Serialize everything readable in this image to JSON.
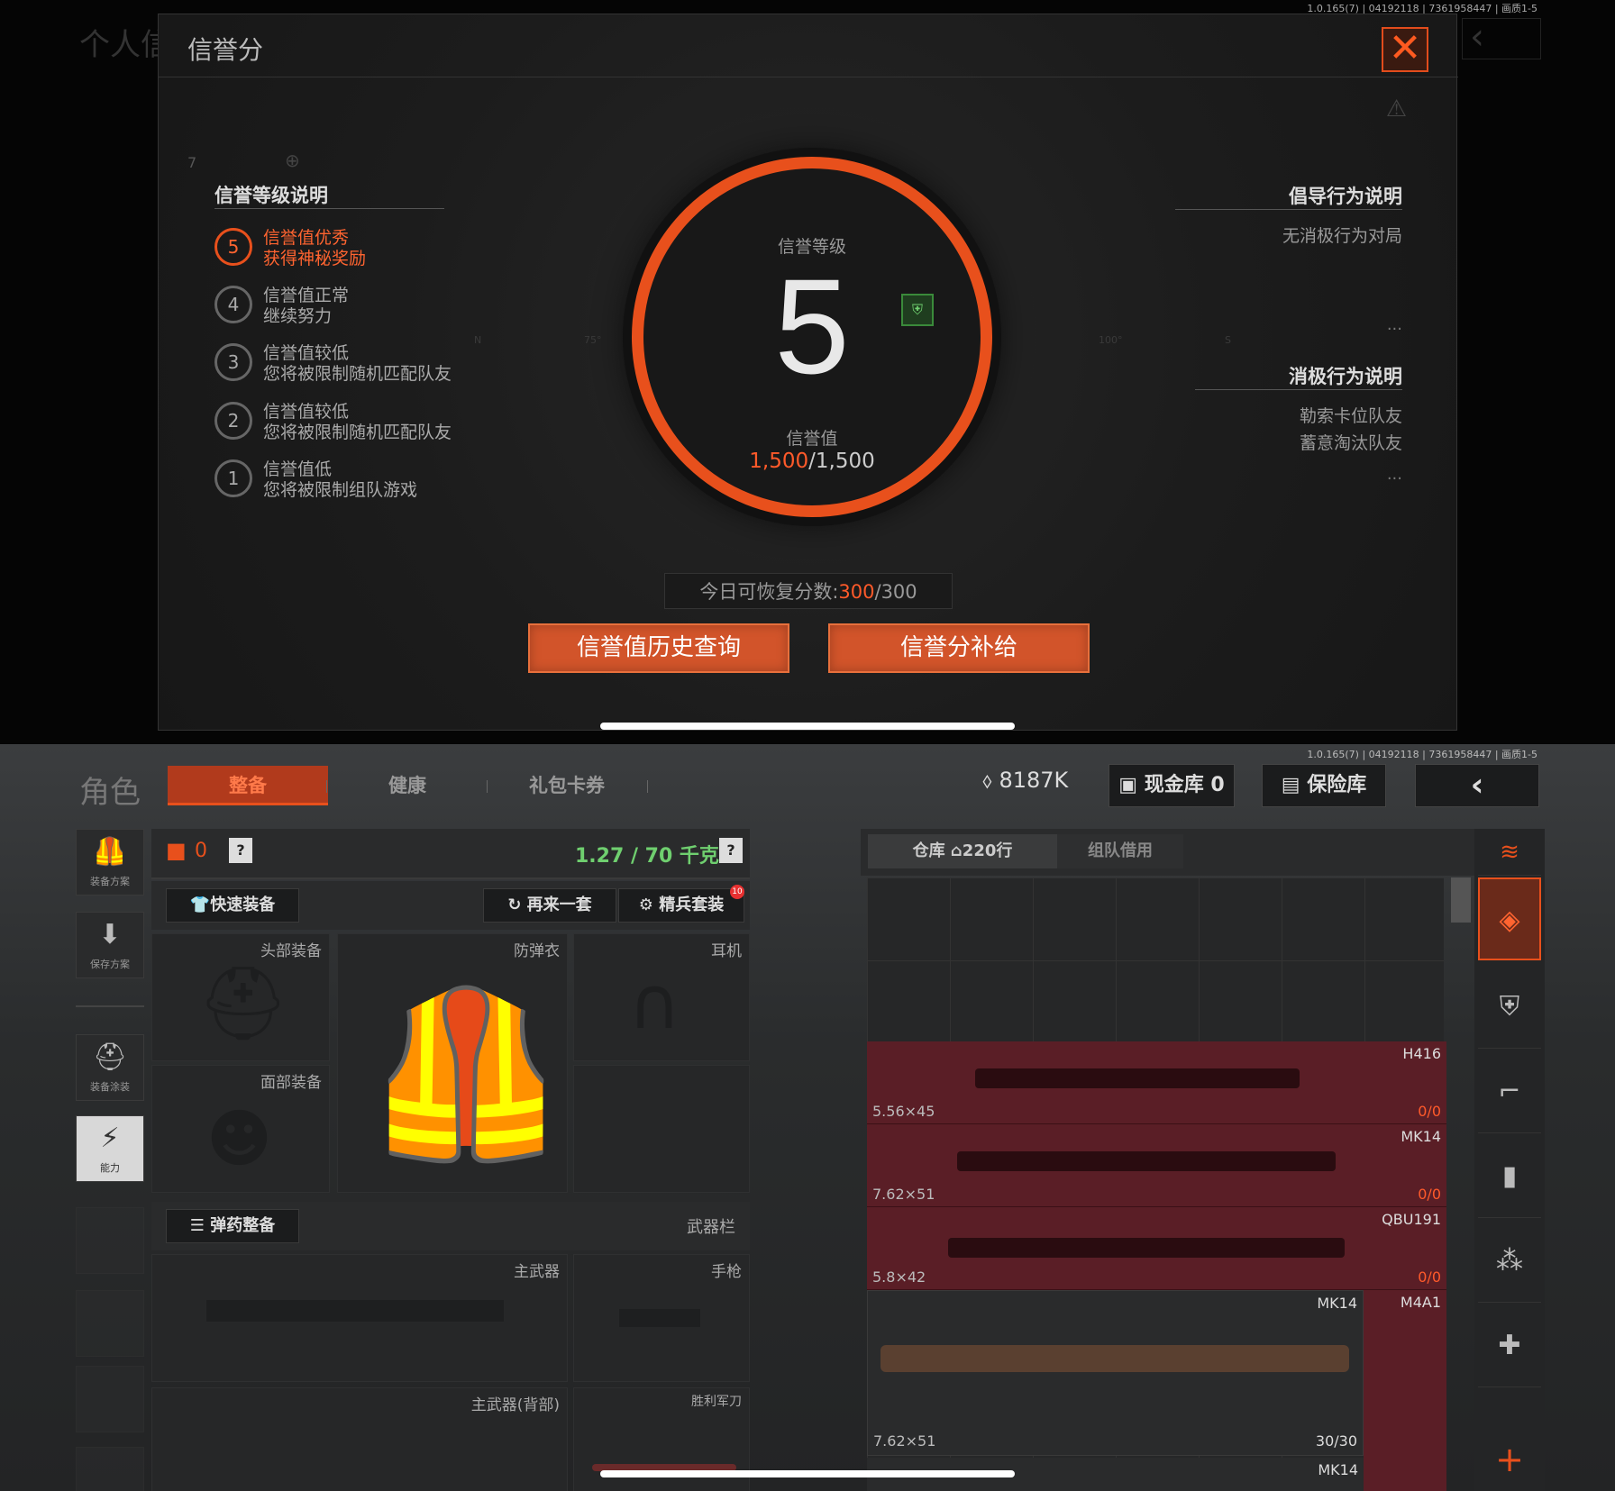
{
  "top": {
    "version": "1.0.165(7) | 04192118 | 7361958447 | 画质1-5",
    "bg_title": "个人信",
    "modal": {
      "title": "信誉分",
      "left": {
        "heading": "信誉等级说明",
        "levels": [
          {
            "num": "5",
            "t1": "信誉值优秀",
            "t2": "获得神秘奖励"
          },
          {
            "num": "4",
            "t1": "信誉值正常",
            "t2": "继续努力"
          },
          {
            "num": "3",
            "t1": "信誉值较低",
            "t2": "您将被限制随机匹配队友"
          },
          {
            "num": "2",
            "t1": "信誉值较低",
            "t2": "您将被限制随机匹配队友"
          },
          {
            "num": "1",
            "t1": "信誉值低",
            "t2": "您将被限制组队游戏"
          }
        ],
        "small_num": "7"
      },
      "center": {
        "level_label": "信誉等级",
        "level": "5",
        "value_label": "信誉值",
        "value_current": "1,500",
        "value_max": "/1,500",
        "compass": [
          "N",
          "75°",
          "100°",
          "S"
        ]
      },
      "right": {
        "encourage_heading": "倡导行为说明",
        "encourage_items": [
          "无消极行为对局"
        ],
        "negative_heading": "消极行为说明",
        "negative_items": [
          "勒索卡位队友",
          "蓄意淘汰队友"
        ],
        "more": "..."
      },
      "recover_label": "今日可恢复分数:",
      "recover_current": "300",
      "recover_max": "/300",
      "btn_history": "信誉值历史查询",
      "btn_supply": "信誉分补给"
    }
  },
  "bottom": {
    "version": "1.0.165(7) | 04192118 | 7361958447 | 画质1-5",
    "role": "角色",
    "tabs": [
      "整备",
      "健康",
      "礼包卡券"
    ],
    "money": "8187K",
    "cash_vault": "现金库 0",
    "safe_vault": "保险库",
    "side": [
      "装备方案",
      "保存方案",
      "装备涂装",
      "能力"
    ],
    "backpack_count": "0",
    "weight": "1.27 / 70 千克",
    "quick_equip": "快速装备",
    "again": "再来一套",
    "elite": "精兵套装",
    "elite_badge": "10",
    "slots": {
      "head": "头部装备",
      "armor": "防弹衣",
      "ear": "耳机",
      "face": "面部装备",
      "ammo": "弹药整备",
      "weapon_bar": "武器栏",
      "main": "主武器",
      "pistol": "手枪",
      "main_back": "主武器(背部)",
      "knife": "胜利军刀"
    },
    "warehouse_tab": "仓库",
    "warehouse_rows": "220行",
    "team_borrow": "组队借用",
    "weapons": [
      {
        "name": "H416",
        "cal": "5.56×45",
        "count": "0/0"
      },
      {
        "name": "MK14",
        "cal": "7.62×51",
        "count": "0/0"
      },
      {
        "name": "QBU191",
        "cal": "5.8×42",
        "count": "0/0"
      }
    ],
    "big_weapon": {
      "name": "MK14",
      "cal": "7.62×51",
      "count": "30/30"
    },
    "side_weapon": {
      "name": "M4A1"
    },
    "bottom_peek": "MK14",
    "add": "+"
  },
  "colors": {
    "accent": "#e8501c",
    "weapon_row": "#5a1e26",
    "green": "#6fcf6f"
  }
}
